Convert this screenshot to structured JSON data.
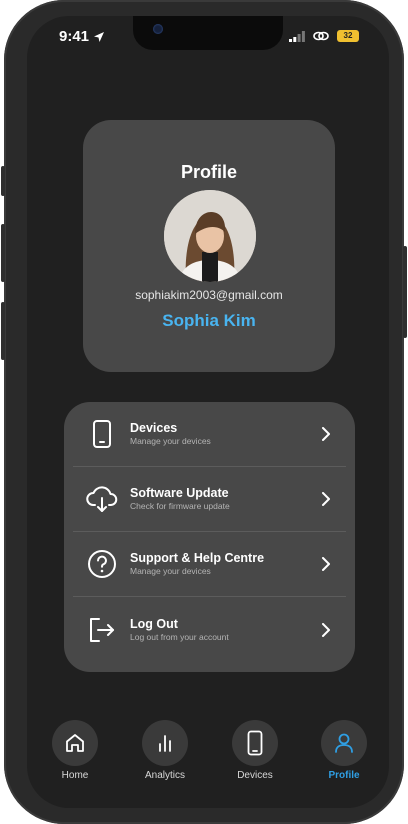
{
  "status_bar": {
    "time": "9:41",
    "battery": "32"
  },
  "profile": {
    "title": "Profile",
    "email": "sophiakim2003@gmail.com",
    "name": "Sophia Kim"
  },
  "menu": [
    {
      "title": "Devices",
      "subtitle": "Manage your devices",
      "icon": "phone-icon"
    },
    {
      "title": "Software Update",
      "subtitle": "Check for firmware update",
      "icon": "cloud-download-icon"
    },
    {
      "title": "Support & Help Centre",
      "subtitle": "Manage your devices",
      "icon": "help-icon"
    },
    {
      "title": "Log Out",
      "subtitle": "Log out from your account",
      "icon": "logout-icon"
    }
  ],
  "tabs": [
    {
      "label": "Home",
      "icon": "home-icon",
      "active": false
    },
    {
      "label": "Analytics",
      "icon": "analytics-icon",
      "active": false
    },
    {
      "label": "Devices",
      "icon": "phone-icon",
      "active": false
    },
    {
      "label": "Profile",
      "icon": "user-icon",
      "active": true
    }
  ],
  "colors": {
    "accent": "#2f9fe4",
    "name": "#49b4f0",
    "card": "#484848",
    "background": "#202020"
  }
}
